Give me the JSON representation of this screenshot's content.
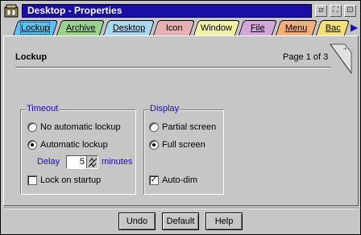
{
  "window": {
    "title": "Desktop - Properties"
  },
  "tabs": [
    {
      "label": "Lockup",
      "color": "#5ec1f2"
    },
    {
      "label": "Archive",
      "color": "#9bd38e"
    },
    {
      "label": "Desktop",
      "color": "#a8d9ef"
    },
    {
      "label": "Icon",
      "color": "#e6b1b1"
    },
    {
      "label": "Window",
      "color": "#f2f2a4"
    },
    {
      "label": "File",
      "color": "#d2a8d8"
    },
    {
      "label": "Menu",
      "color": "#f1b07a"
    },
    {
      "label": "Bac",
      "color": "#f5e07a"
    }
  ],
  "page": {
    "title": "Lockup",
    "page_count": "Page 1 of 3"
  },
  "timeout": {
    "legend": "Timeout",
    "no_lockup": "No automatic lockup",
    "auto_lockup": "Automatic lockup",
    "selected": "Automatic lockup",
    "delay_label": "Delay",
    "delay_value": "5",
    "delay_unit": "minutes",
    "lock_on_startup": "Lock on startup",
    "lock_on_startup_checked": false
  },
  "display": {
    "legend": "Display",
    "partial": "Partial screen",
    "full": "Full screen",
    "selected": "Full screen",
    "auto_dim": "Auto-dim",
    "auto_dim_checked": true
  },
  "buttons": {
    "undo": "Undo",
    "default": "Default",
    "help": "Help"
  },
  "colors": {
    "title_bar": "#1a0ea6",
    "legend_text": "#1a0ea6"
  }
}
